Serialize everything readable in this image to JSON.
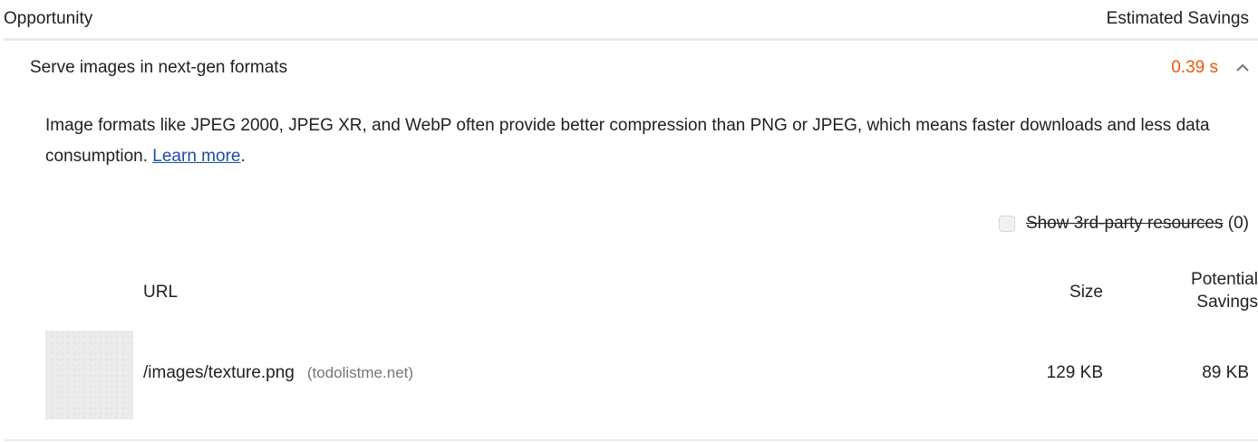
{
  "header": {
    "opportunity_label": "Opportunity",
    "estimated_savings_label": "Estimated Savings"
  },
  "audit": {
    "title": "Serve images in next-gen formats",
    "savings": "0.39 s",
    "savings_color": "#e8590c",
    "expanded_icon": "chevron-up-icon",
    "description_text": "Image formats like JPEG 2000, JPEG XR, and WebP often provide better compression than PNG or JPEG, which means faster downloads and less data consumption. ",
    "learn_more_label": "Learn more",
    "description_end": "."
  },
  "filter": {
    "checked": false,
    "label": "Show 3rd-party resources",
    "count": "(0)"
  },
  "table": {
    "columns": {
      "url": "URL",
      "size": "Size",
      "potential_savings_line1": "Potential",
      "potential_savings_line2": "Savings"
    },
    "rows": [
      {
        "url": "/images/texture.png",
        "host": "(todolistme.net)",
        "size": "129 KB",
        "potential_savings": "89 KB"
      }
    ]
  }
}
